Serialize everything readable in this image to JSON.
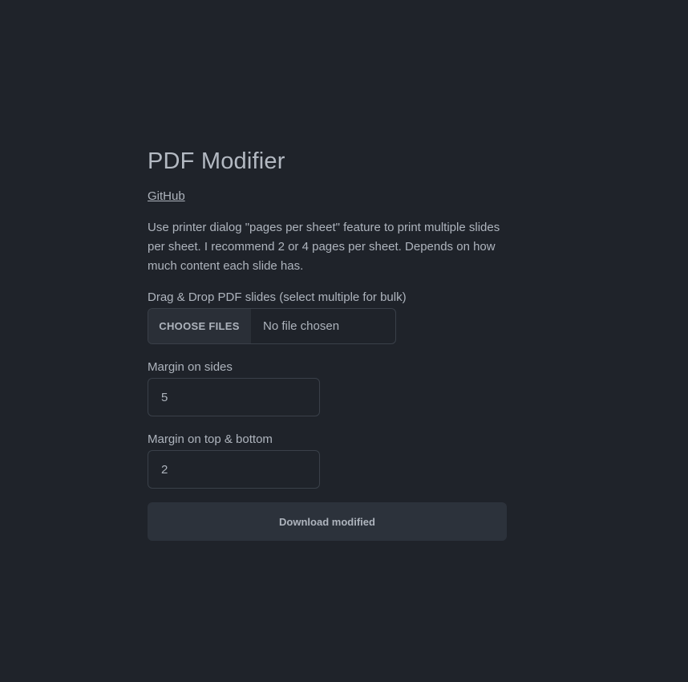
{
  "header": {
    "title": "PDF Modifier",
    "github_link": "GitHub"
  },
  "description": "Use printer dialog \"pages per sheet\" feature to print multiple slides per sheet. I recommend 2 or 4 pages per sheet. Depends on how much content each slide has.",
  "upload": {
    "label": "Drag & Drop PDF slides (select multiple for bulk)",
    "button_label": "CHOOSE FILES",
    "status": "No file chosen"
  },
  "margin_sides": {
    "label": "Margin on sides",
    "value": "5"
  },
  "margin_top_bottom": {
    "label": "Margin on top & bottom",
    "value": "2"
  },
  "actions": {
    "download_label": "Download modified"
  },
  "colors": {
    "background": "#1f232a",
    "text": "#aeb4bd",
    "button_bg": "#2c323b",
    "border": "#3a4049"
  }
}
